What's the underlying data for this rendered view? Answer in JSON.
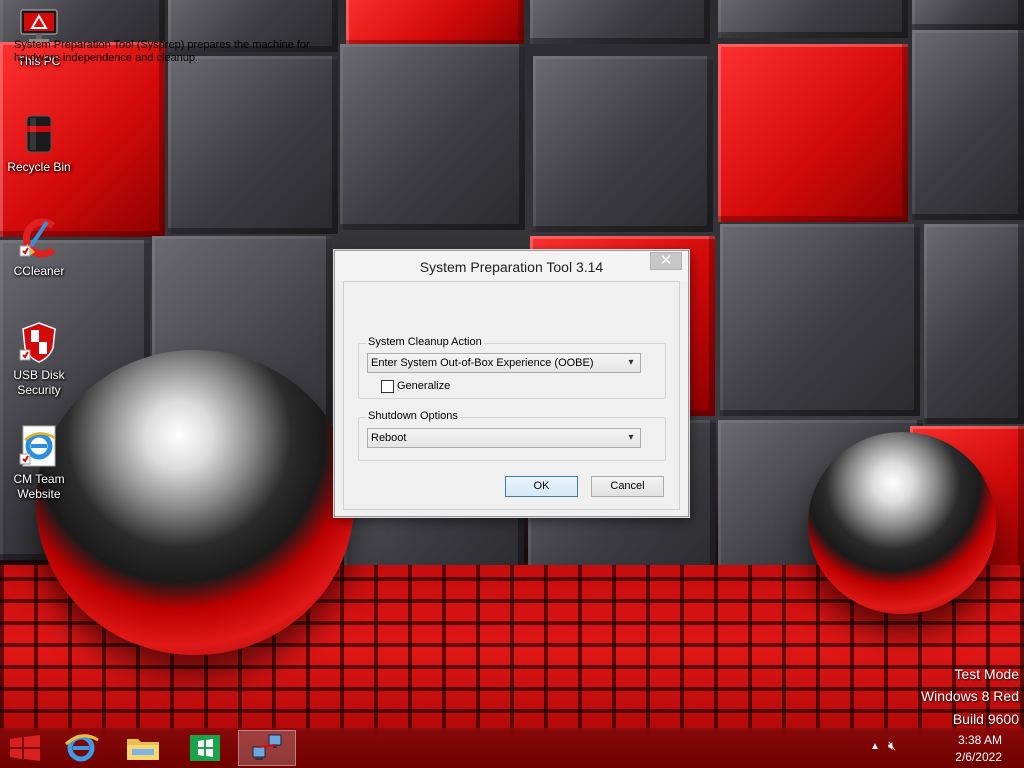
{
  "desktop": {
    "icons": [
      {
        "label": "This PC",
        "icon": "monitor-icon"
      },
      {
        "label": "Recycle Bin",
        "icon": "recycle-bin-icon"
      },
      {
        "label": "CCleaner",
        "icon": "ccleaner-icon"
      },
      {
        "label": "USB Disk Security",
        "icon": "shield-icon"
      },
      {
        "label": "CM Team Website",
        "icon": "internet-explorer-icon"
      }
    ],
    "watermark": {
      "line1": "Test Mode",
      "line2": "Windows 8 Red",
      "line3": "Build 9600"
    }
  },
  "dialog": {
    "title": "System Preparation Tool 3.14",
    "close_label": "✕",
    "description": "System Preparation Tool (Sysprep) prepares the machine for hardware independence and cleanup.",
    "cleanup": {
      "legend": "System Cleanup Action",
      "selected": "Enter System Out-of-Box Experience (OOBE)",
      "generalize_label": "Generalize",
      "generalize_checked": false
    },
    "shutdown": {
      "legend": "Shutdown Options",
      "selected": "Reboot"
    },
    "ok_label": "OK",
    "cancel_label": "Cancel"
  },
  "taskbar": {
    "items": [
      {
        "icon": "windows-start-icon"
      },
      {
        "icon": "internet-explorer-icon"
      },
      {
        "icon": "file-explorer-icon"
      },
      {
        "icon": "store-icon"
      },
      {
        "icon": "network-sysprep-icon"
      }
    ],
    "time": "3:38 AM",
    "date": "2/6/2022"
  },
  "colors": {
    "accent_red": "#d40a0a",
    "taskbar": "#8c0a0a",
    "ok_border": "#3c7fb1"
  }
}
